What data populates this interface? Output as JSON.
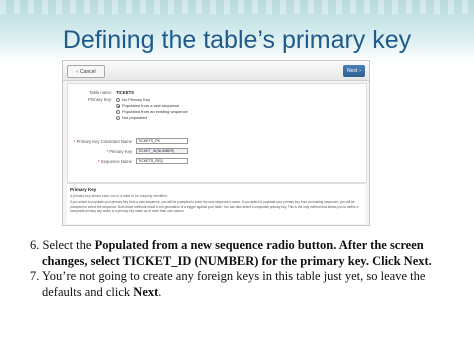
{
  "slide": {
    "title": "Defining the table’s primary key"
  },
  "toolbar": {
    "cancel_label": "Cancel",
    "next_label": "Next"
  },
  "form": {
    "table_name_label": "Table name:",
    "table_name_value": "TICKETS",
    "primary_key_label": "Primary Key:",
    "primary_key_options": [
      "No Primary Key",
      "Populated from a new sequence",
      "Populated from an existing sequence",
      "Not populated"
    ],
    "selected_option_index": 1,
    "constraint_label": "Primary Key Constraint Name",
    "constraint_value": "TICKETS_PK",
    "pk_label": "Primary Key",
    "pk_value": "TICKET_ID(NUMBER)",
    "sequence_label": "Sequence Name",
    "sequence_value": "TICKETS_SEQ",
    "required_mark": "*"
  },
  "help": {
    "title": "Primary Key",
    "subtitle": "A primary key allows each row in a table to be uniquely identified.",
    "body": "If you select to populate your primary key from a new sequence, you will be prompted to enter the new sequence's name. If you select to populate your primary key from an existing sequence, you will be prompted to select the sequence. Both these methods result in the generation of a trigger against your table. You can also select a composite primary key. This is the only method that allows you to define a composite primary key which is a primary key made up of more than one column."
  },
  "instructions": {
    "step6_prefix": "6. Select the ",
    "step6_bold1": "Populated from a new sequence radio button. After the screen changes, select TICKET_ID (NUMBER) for the primary key. Click Next.",
    "step7_prefix": "7. You’re not going to create any foreign keys in this table just yet, so leave the defaults and click ",
    "step7_bold": "Next",
    "step7_suffix": "."
  },
  "colors": {
    "title": "#1e5a8a",
    "band": "#b7d9db",
    "next_button": "#2e5f93"
  }
}
